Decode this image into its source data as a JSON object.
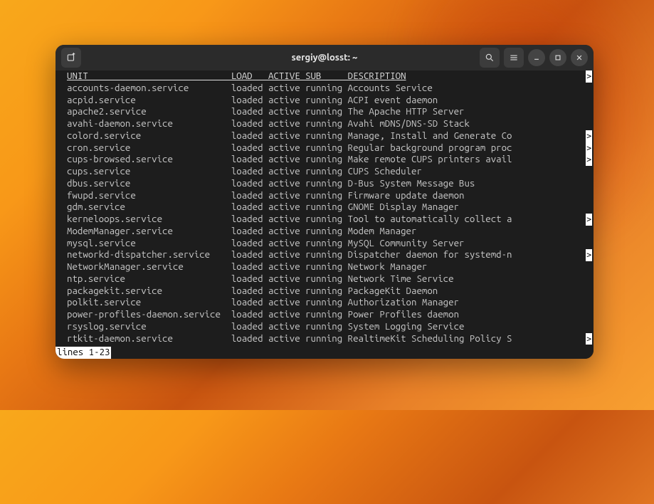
{
  "window": {
    "title": "sergiy@losst: ~"
  },
  "headers": {
    "unit": "UNIT",
    "load": "LOAD",
    "active": "ACTIVE",
    "sub": "SUB",
    "description": "DESCRIPTION"
  },
  "services": [
    {
      "unit": "accounts-daemon.service",
      "load": "loaded",
      "active": "active",
      "sub": "running",
      "desc": "Accounts Service",
      "overflow": false
    },
    {
      "unit": "acpid.service",
      "load": "loaded",
      "active": "active",
      "sub": "running",
      "desc": "ACPI event daemon",
      "overflow": false
    },
    {
      "unit": "apache2.service",
      "load": "loaded",
      "active": "active",
      "sub": "running",
      "desc": "The Apache HTTP Server",
      "overflow": false
    },
    {
      "unit": "avahi-daemon.service",
      "load": "loaded",
      "active": "active",
      "sub": "running",
      "desc": "Avahi mDNS/DNS-SD Stack",
      "overflow": false
    },
    {
      "unit": "colord.service",
      "load": "loaded",
      "active": "active",
      "sub": "running",
      "desc": "Manage, Install and Generate Co",
      "overflow": true
    },
    {
      "unit": "cron.service",
      "load": "loaded",
      "active": "active",
      "sub": "running",
      "desc": "Regular background program proc",
      "overflow": true
    },
    {
      "unit": "cups-browsed.service",
      "load": "loaded",
      "active": "active",
      "sub": "running",
      "desc": "Make remote CUPS printers avail",
      "overflow": true
    },
    {
      "unit": "cups.service",
      "load": "loaded",
      "active": "active",
      "sub": "running",
      "desc": "CUPS Scheduler",
      "overflow": false
    },
    {
      "unit": "dbus.service",
      "load": "loaded",
      "active": "active",
      "sub": "running",
      "desc": "D-Bus System Message Bus",
      "overflow": false
    },
    {
      "unit": "fwupd.service",
      "load": "loaded",
      "active": "active",
      "sub": "running",
      "desc": "Firmware update daemon",
      "overflow": false
    },
    {
      "unit": "gdm.service",
      "load": "loaded",
      "active": "active",
      "sub": "running",
      "desc": "GNOME Display Manager",
      "overflow": false
    },
    {
      "unit": "kerneloops.service",
      "load": "loaded",
      "active": "active",
      "sub": "running",
      "desc": "Tool to automatically collect a",
      "overflow": true
    },
    {
      "unit": "ModemManager.service",
      "load": "loaded",
      "active": "active",
      "sub": "running",
      "desc": "Modem Manager",
      "overflow": false
    },
    {
      "unit": "mysql.service",
      "load": "loaded",
      "active": "active",
      "sub": "running",
      "desc": "MySQL Community Server",
      "overflow": false
    },
    {
      "unit": "networkd-dispatcher.service",
      "load": "loaded",
      "active": "active",
      "sub": "running",
      "desc": "Dispatcher daemon for systemd-n",
      "overflow": true
    },
    {
      "unit": "NetworkManager.service",
      "load": "loaded",
      "active": "active",
      "sub": "running",
      "desc": "Network Manager",
      "overflow": false
    },
    {
      "unit": "ntp.service",
      "load": "loaded",
      "active": "active",
      "sub": "running",
      "desc": "Network Time Service",
      "overflow": false
    },
    {
      "unit": "packagekit.service",
      "load": "loaded",
      "active": "active",
      "sub": "running",
      "desc": "PackageKit Daemon",
      "overflow": false
    },
    {
      "unit": "polkit.service",
      "load": "loaded",
      "active": "active",
      "sub": "running",
      "desc": "Authorization Manager",
      "overflow": false
    },
    {
      "unit": "power-profiles-daemon.service",
      "load": "loaded",
      "active": "active",
      "sub": "running",
      "desc": "Power Profiles daemon",
      "overflow": false
    },
    {
      "unit": "rsyslog.service",
      "load": "loaded",
      "active": "active",
      "sub": "running",
      "desc": "System Logging Service",
      "overflow": false
    },
    {
      "unit": "rtkit-daemon.service",
      "load": "loaded",
      "active": "active",
      "sub": "running",
      "desc": "RealtimeKit Scheduling Policy S",
      "overflow": true
    }
  ],
  "statusline": "lines 1-23",
  "gt": ">"
}
